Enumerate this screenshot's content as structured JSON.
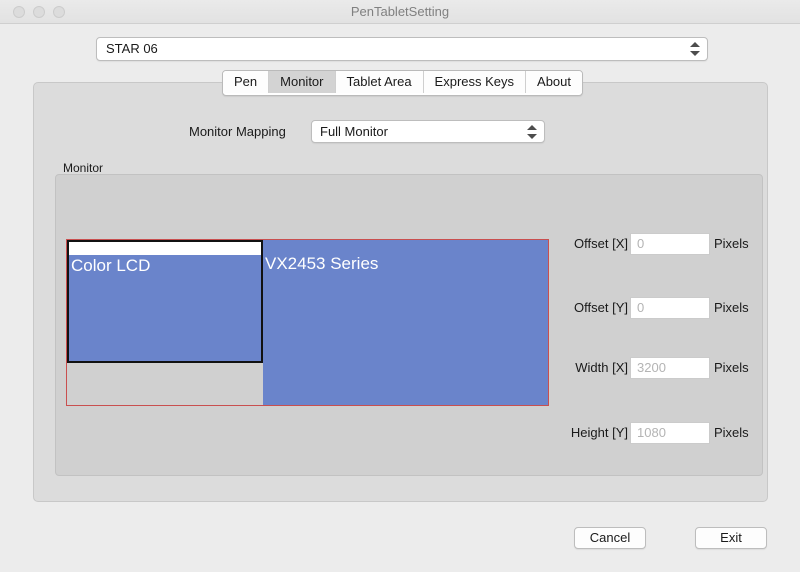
{
  "window": {
    "title": "PenTabletSetting",
    "traffic_lights": [
      "close",
      "minimize",
      "maximize"
    ]
  },
  "device_selector": {
    "value": "STAR 06",
    "placeholder": "STAR 06"
  },
  "tabs": [
    {
      "label": "Pen",
      "active": false
    },
    {
      "label": "Monitor",
      "active": true
    },
    {
      "label": "Tablet Area",
      "active": false
    },
    {
      "label": "Express Keys",
      "active": false
    },
    {
      "label": "About",
      "active": false
    }
  ],
  "monitor_mapping": {
    "label": "Monitor Mapping",
    "value": "Full Monitor",
    "options": [
      "Full Monitor"
    ]
  },
  "monitor_group": {
    "label": "Monitor",
    "displays": [
      {
        "name": "Color LCD",
        "position": "left",
        "has_menubar": true
      },
      {
        "name": "VX2453 Series",
        "position": "right",
        "has_menubar": false
      }
    ],
    "fields": [
      {
        "label": "Offset [X]",
        "value": "0",
        "units": "Pixels",
        "enabled": false
      },
      {
        "label": "Offset [Y]",
        "value": "0",
        "units": "Pixels",
        "enabled": false
      },
      {
        "label": "Width [X]",
        "value": "3200",
        "units": "Pixels",
        "enabled": false
      },
      {
        "label": "Height [Y]",
        "value": "1080",
        "units": "Pixels",
        "enabled": false
      }
    ]
  },
  "footer": {
    "cancel_label": "Cancel",
    "exit_label": "Exit"
  },
  "colors": {
    "window_bg": "#ececec",
    "panel_bg": "#dcdcdc",
    "groupbox_bg": "#d0d0d0",
    "display_blue": "#6a84cb",
    "selection_outline": "#c94f4f",
    "titlebar_text": "#808080"
  }
}
